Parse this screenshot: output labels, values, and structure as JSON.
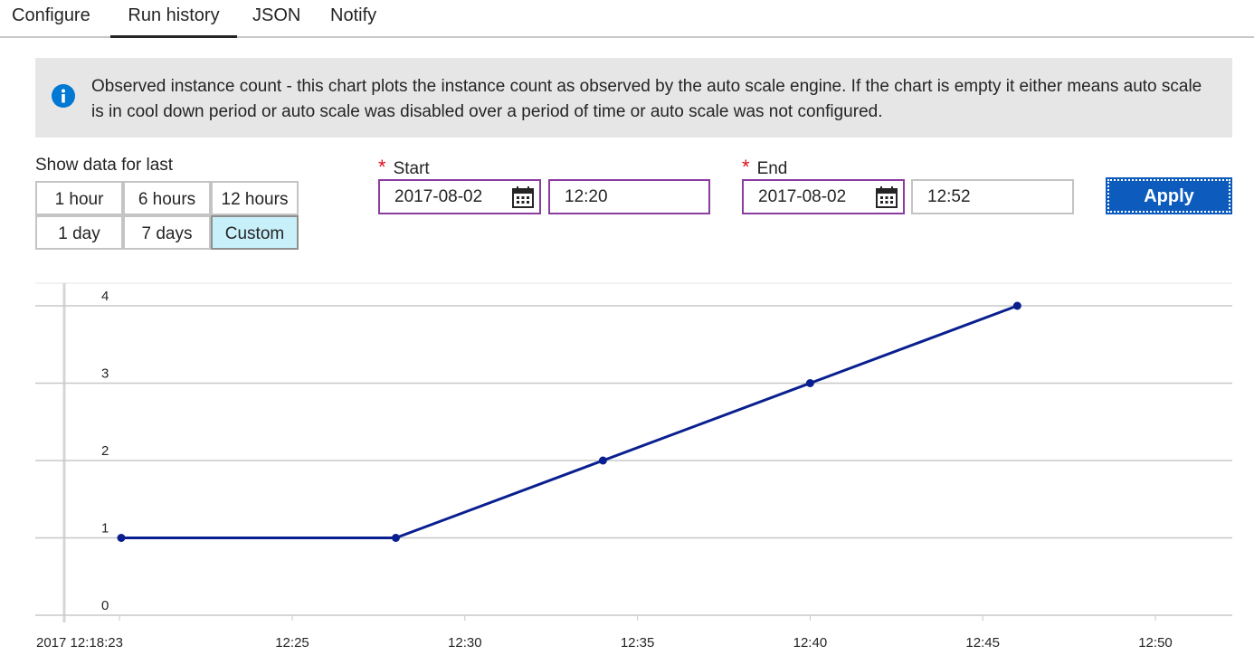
{
  "tabs": [
    {
      "label": "Configure",
      "active": false
    },
    {
      "label": "Run history",
      "active": true
    },
    {
      "label": "JSON",
      "active": false
    },
    {
      "label": "Notify",
      "active": false
    }
  ],
  "info": {
    "icon": "info-icon",
    "text": "Observed instance count - this chart plots the instance count as observed by the auto scale engine. If the chart is empty it either means auto scale is in cool down period or auto scale was disabled over a period of time or auto scale was not configured."
  },
  "range": {
    "label": "Show data for last",
    "options": [
      "1 hour",
      "6 hours",
      "12 hours",
      "1 day",
      "7 days",
      "Custom"
    ],
    "selected": "Custom"
  },
  "start": {
    "required_mark": "*",
    "label": "Start",
    "date": "2017-08-02",
    "time": "12:20"
  },
  "end": {
    "required_mark": "*",
    "label": "End",
    "date": "2017-08-02",
    "time": "12:52"
  },
  "apply_label": "Apply",
  "colors": {
    "accent": "#0d5cbd",
    "series": "#0a1f8f",
    "selected_bg": "#c8f0fb",
    "date_border": "#8a3d9e"
  },
  "chart_data": {
    "type": "line",
    "x_tick_labels": [
      "2017 12:18:23",
      "12:25",
      "12:30",
      "12:35",
      "12:40",
      "12:45",
      "12:50"
    ],
    "y_tick_labels": [
      "0",
      "1",
      "2",
      "3",
      "4"
    ],
    "ylim": [
      0,
      4
    ],
    "xlim": [
      "12:18:23",
      "12:51"
    ],
    "series": [
      {
        "x": [
          "12:20",
          "12:28",
          "12:34",
          "12:40",
          "12:46"
        ],
        "values": [
          1,
          1,
          2,
          3,
          4
        ]
      }
    ],
    "grid": true
  }
}
